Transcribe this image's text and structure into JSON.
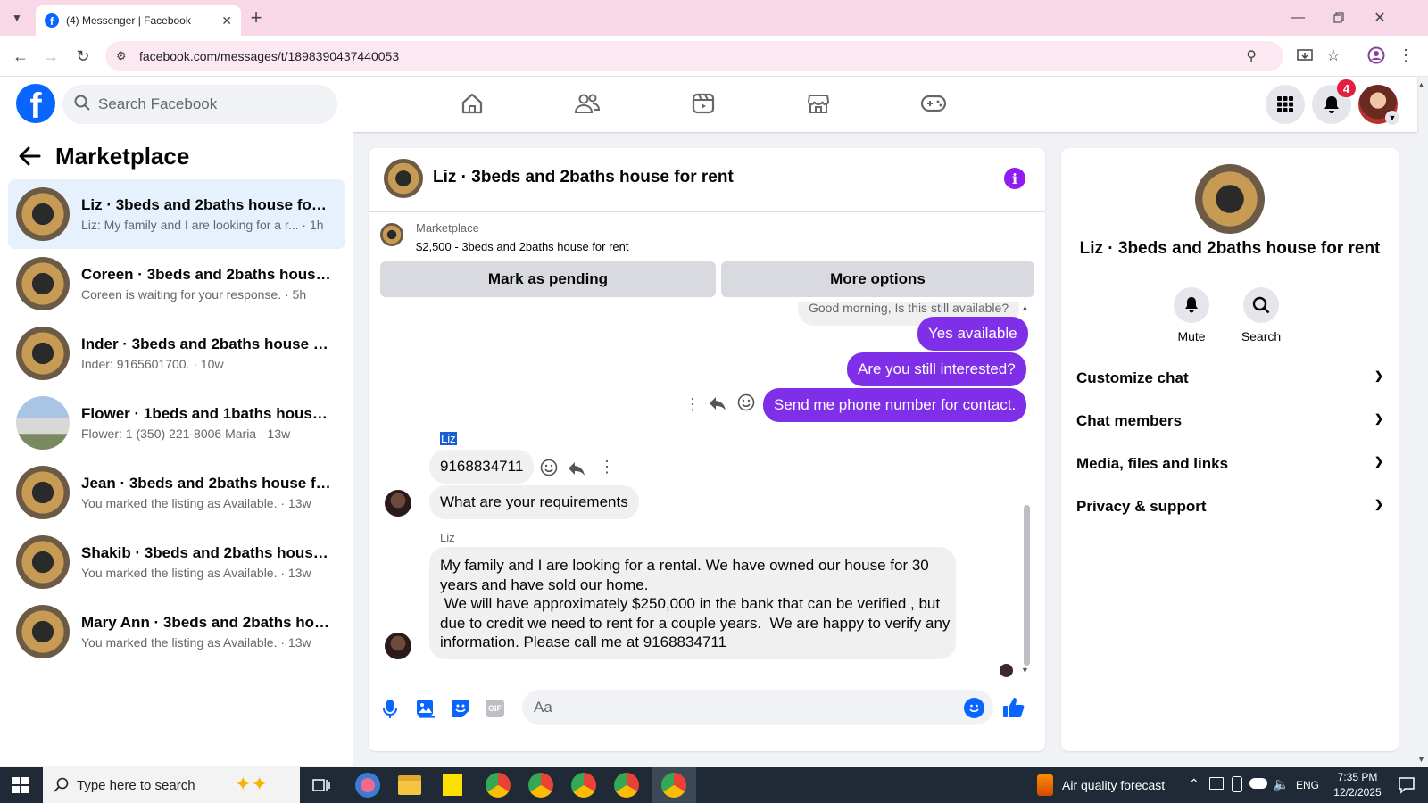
{
  "browser": {
    "tab_title": "(4) Messenger | Facebook",
    "url": "facebook.com/messages/t/1898390437440053"
  },
  "header": {
    "search_placeholder": "Search Facebook",
    "notification_count": "4"
  },
  "left": {
    "title": "Marketplace",
    "conversations": [
      {
        "name": "Liz · 3beds and 2baths house for r...",
        "preview": "Liz: My family and I are looking for a r... · 1h"
      },
      {
        "name": "Coreen · 3beds and 2baths house f...",
        "preview": "Coreen is waiting for your response. · 5h"
      },
      {
        "name": "Inder · 3beds and 2baths house fo...",
        "preview": "Inder: 9165601700. · 10w"
      },
      {
        "name": "Flower · 1beds and 1baths house f...",
        "preview": "Flower: 1 (350) 221-8006 Maria · 13w"
      },
      {
        "name": "Jean · 3beds and 2baths house for ...",
        "preview": "You marked the listing as Available. · 13w"
      },
      {
        "name": "Shakib · 3beds and 2baths house f...",
        "preview": "You marked the listing as Available. · 13w"
      },
      {
        "name": "Mary Ann · 3beds and 2baths hou...",
        "preview": "You marked the listing as Available. · 13w"
      }
    ]
  },
  "chat": {
    "title": "Liz · 3beds and 2baths house for rent",
    "listing_label": "Marketplace",
    "listing_detail": "$2,500 - 3beds and 2baths house for rent",
    "mark_pending": "Mark as pending",
    "more_options": "More options",
    "msg_cut": "Good morning, Is this still available?",
    "msg_me_1": "Yes available",
    "msg_me_2": "Are you still interested?",
    "msg_me_3": "Send me phone number for contact.",
    "sender_1": "Liz",
    "msg_them_1": "9168834711",
    "msg_them_2": "What are your requirements",
    "sender_2": "Liz",
    "msg_them_3_l1": "My family and I are looking for a rental. We have owned our house for 30",
    "msg_them_3_l2": "years and have sold our home.",
    "msg_them_3_l3": " We will have approximately $250,000 in the bank that can be verified , but",
    "msg_them_3_l4": "due to credit we need to rent for a couple years.  We are happy to verify any",
    "msg_them_3_l5": "information. Please call me at 9168834711",
    "composer_placeholder": "Aa"
  },
  "right": {
    "title": "Liz · 3beds and 2baths house for rent",
    "mute": "Mute",
    "search": "Search",
    "sections": [
      "Customize chat",
      "Chat members",
      "Media, files and links",
      "Privacy & support"
    ]
  },
  "taskbar": {
    "search_placeholder": "Type here to search",
    "weather": "Air quality forecast",
    "lang": "ENG",
    "time": "7:35 PM",
    "date": "12/2/2025"
  },
  "colors": {
    "accent": "#7f2fe8",
    "fb_blue": "#0866ff",
    "badge": "#e41e3f"
  }
}
